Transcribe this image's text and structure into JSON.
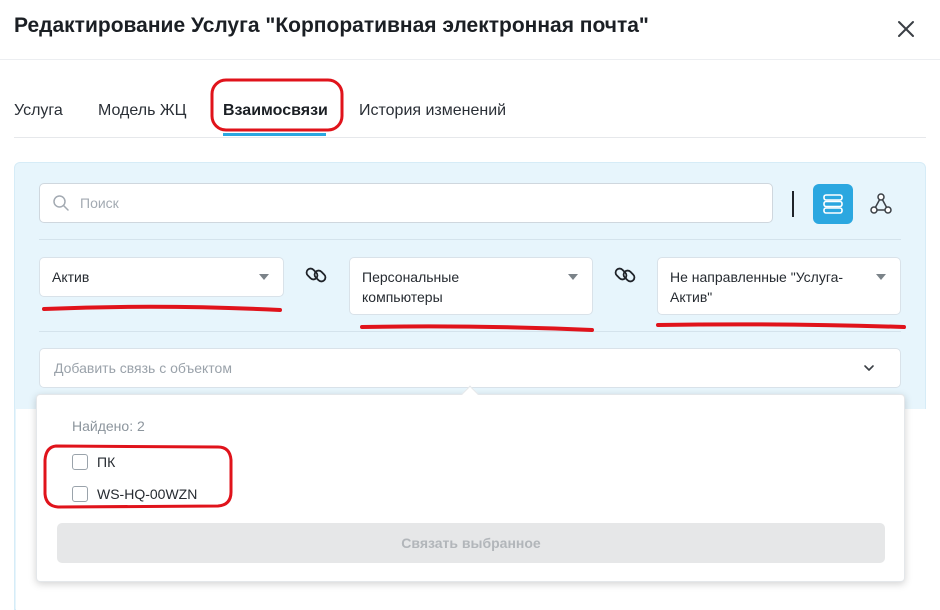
{
  "dialog": {
    "title": "Редактирование Услуга \"Корпоративная электронная почта\""
  },
  "tabs": [
    {
      "label": "Услуга"
    },
    {
      "label": "Модель ЖЦ"
    },
    {
      "label": "Взаимосвязи",
      "active": true
    },
    {
      "label": "История изменений"
    }
  ],
  "search": {
    "placeholder": "Поиск",
    "value": ""
  },
  "filters": {
    "type": "Актив",
    "category_line1": "Персональные",
    "category_line2": "компьютеры",
    "direction_line1": "Не направленные \"Услуга-",
    "direction_line2": "Актив\""
  },
  "add_link": {
    "placeholder": "Добавить связь с объектом"
  },
  "results": {
    "found_text": "Найдено: 2",
    "items": [
      {
        "label": "ПК",
        "checked": false
      },
      {
        "label": "WS-HQ-00WZN",
        "checked": false
      }
    ],
    "link_button": "Связать выбранное"
  },
  "icons": [
    "close-icon",
    "search-icon",
    "list-view-icon",
    "graph-view-icon",
    "link-icon",
    "chevron-down-icon"
  ],
  "colors": {
    "accent": "#2ba7e0",
    "panel_bg": "#e7f5fc",
    "annotation": "#e0131b"
  }
}
